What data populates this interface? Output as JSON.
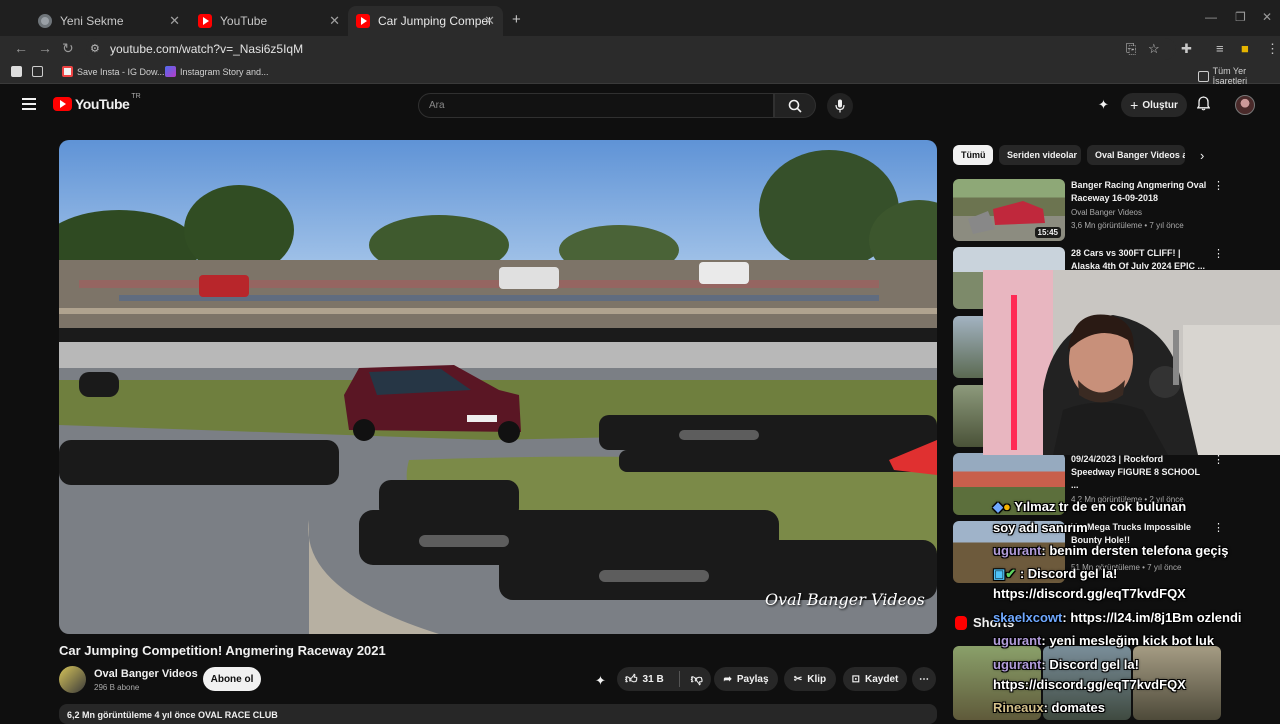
{
  "browser": {
    "tabs": [
      {
        "label": "Yeni Sekme",
        "icon": "chrome-icon"
      },
      {
        "label": "YouTube",
        "icon": "youtube-icon"
      },
      {
        "label": "Car Jumping Competition! Ang",
        "icon": "youtube-icon"
      }
    ],
    "url": "youtube.com/watch?v=_Nasi6z5IqM",
    "bookmarks": [
      {
        "label": "Save Insta - IG Dow..."
      },
      {
        "label": "Instagram Story and..."
      }
    ],
    "all_bookmarks_label": "Tüm Yer İşaretleri"
  },
  "youtube": {
    "logo_text": "YouTube",
    "country_code": "TR",
    "search_placeholder": "Ara",
    "create_label": "Oluştur"
  },
  "video": {
    "title": "Car Jumping Competition! Angmering Raceway 2021",
    "watermark": "Oval Banger Videos",
    "channel_name": "Oval Banger Videos",
    "channel_subs": "296 B abone",
    "subscribe_label": "Abone ol",
    "likes": "31 B",
    "share_label": "Paylaş",
    "clip_label": "Klip",
    "save_label": "Kaydet",
    "description_meta": "6,2 Mn görüntüleme  4 yıl önce  OVAL RACE CLUB"
  },
  "chips": [
    {
      "label": "Tümü",
      "selected": true
    },
    {
      "label": "Seriden videolar",
      "selected": false
    },
    {
      "label": "Oval Banger Videos ad",
      "selected": false
    }
  ],
  "recommendations": [
    {
      "title": "Banger Racing Angmering Oval Raceway 16-09-2018",
      "channel": "Oval Banger Videos",
      "meta": "3,6 Mn görüntüleme • 7 yıl önce",
      "duration": "15:45"
    },
    {
      "title": "28 Cars vs 300FT CLIFF! | Alaska 4th Of July 2024 EPIC ...",
      "channel": "",
      "meta": "",
      "duration": ""
    },
    {
      "title": "09/24/2023 | Rockford Speedway FIGURE 8 SCHOOL ...",
      "channel": "",
      "meta": "4,2 Mn görüntüleme • 2 yıl önce",
      "duration": ""
    },
    {
      "title": "Vs. Mega Trucks Impossible Bounty Hole!!",
      "channel": "",
      "meta": "51 Mn görüntüleme • 7 yıl önce",
      "duration": ""
    }
  ],
  "shorts_label": "Shorts",
  "chat": [
    {
      "user": "",
      "text": "Yılmaz tr de en cok bulunan"
    },
    {
      "user": "",
      "text": "soy adı sanırım"
    },
    {
      "user": "ugurant",
      "text": ": benim dersten telefona geçiş"
    },
    {
      "user": "",
      "text": ": Discord gel la!"
    },
    {
      "user": "",
      "text": "https://discord.gg/eqT7kvdFQX"
    },
    {
      "user": "skaelxcowt",
      "text": ": https://l24.im/8j1Bm ozlendi"
    },
    {
      "user": "ugurant",
      "text": ": yeni mesleğim kick bot luk"
    },
    {
      "user": "ugurant",
      "text": ": Discord gel la!"
    },
    {
      "user": "",
      "text": "https://discord.gg/eqT7kvdFQX"
    },
    {
      "user": "Rineaux",
      "text": ": domates"
    }
  ],
  "colors": {
    "youtube_red": "#ff0000",
    "background": "#0f0f0f",
    "chip_bg": "#272727"
  }
}
